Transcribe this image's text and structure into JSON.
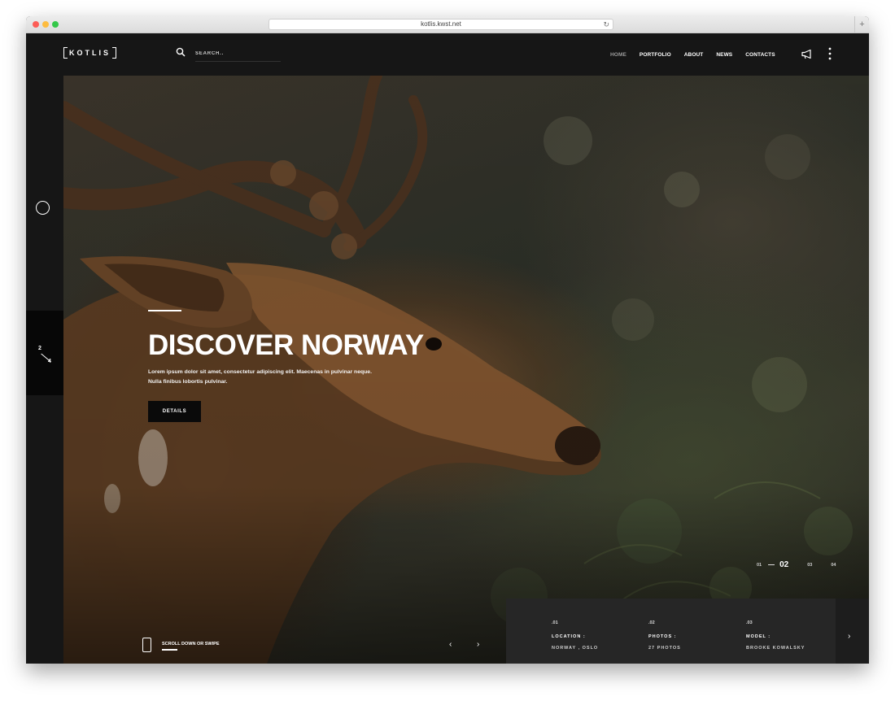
{
  "browser": {
    "url": "kotlis.kwst.net",
    "new_tab_label": "+"
  },
  "header": {
    "logo": "KOTLIS",
    "search_placeholder": "SEARCH..",
    "nav": [
      {
        "label": "HOME",
        "active": true
      },
      {
        "label": "PORTFOLIO",
        "active": false
      },
      {
        "label": "ABOUT",
        "active": false
      },
      {
        "label": "NEWS",
        "active": false
      },
      {
        "label": "CONTACTS",
        "active": false
      }
    ]
  },
  "sidebar": {
    "counter_current": "2",
    "counter_total": "4"
  },
  "hero": {
    "title": "DISCOVER NORWAY",
    "text": "Lorem ipsum dolor sit amet, consectetur adipiscing elit. Maecenas in pulvinar neque. Nulla finibus lobortis pulvinar.",
    "button_label": "DETAILS",
    "scroll_hint": "SCROLL DOWN OR SWIPE",
    "prev_label": "‹",
    "next_label": "›"
  },
  "pager": {
    "items": [
      "01",
      "02",
      "03",
      "04"
    ],
    "active_index": 1
  },
  "info": {
    "items": [
      {
        "num": ".01",
        "label": "LOCATION :",
        "value": "NORWAY , OSLO"
      },
      {
        "num": ".02",
        "label": "PHOTOS :",
        "value": "27 PHOTOS"
      },
      {
        "num": ".03",
        "label": "MODEL :",
        "value": "BROOKE KOWALSKY"
      }
    ],
    "next_label": "›"
  },
  "colors": {
    "background": "#161616",
    "panel": "#262626",
    "button": "#0a0a0a",
    "text": "#ffffff"
  },
  "icons": [
    "search-icon",
    "megaphone-icon",
    "more-vertical-icon",
    "circle-icon",
    "phone-icon",
    "chevron-left-icon",
    "chevron-right-icon",
    "reload-icon"
  ]
}
